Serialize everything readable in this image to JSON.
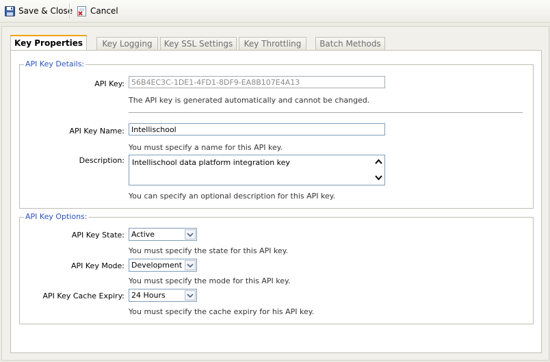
{
  "toolbar": {
    "save_close_label": "Save & Close",
    "cancel_label": "Cancel",
    "save_icon": "floppy-disk-icon",
    "cancel_icon": "cancel-document-icon"
  },
  "tabs": [
    {
      "label": "Key Properties",
      "active": true
    },
    {
      "label": "Key Logging",
      "active": false
    },
    {
      "label": "Key SSL Settings",
      "active": false
    },
    {
      "label": "Key Throttling",
      "active": false
    },
    {
      "label": "Batch Methods",
      "active": false
    }
  ],
  "details": {
    "legend": "API Key Details:",
    "api_key_label": "API Key:",
    "api_key_value": "56B4EC3C-1DE1-4FD1-8DF9-EA8B107E4A13",
    "api_key_hint": "The API key is generated automatically and cannot be changed.",
    "name_label": "API Key Name:",
    "name_value": "Intellischool",
    "name_hint": "You must specify a name for this API key.",
    "description_label": "Description:",
    "description_value": "Intellischool data platform integration key",
    "description_hint": "You can specify an optional description for this API key."
  },
  "options": {
    "legend": "API Key Options:",
    "state_label": "API Key State:",
    "state_value": "Active",
    "state_hint": "You must specify the state for this API key.",
    "mode_label": "API Key Mode:",
    "mode_value": "Development",
    "mode_hint": "You must specify the mode for this API key.",
    "expiry_label": "API Key Cache Expiry:",
    "expiry_value": "24 Hours",
    "expiry_hint": "You must specify the cache expiry for his API key."
  },
  "colors": {
    "accent_tab": "#f0a30a",
    "legend_text": "#2a52be",
    "input_border": "#7f9db9"
  }
}
